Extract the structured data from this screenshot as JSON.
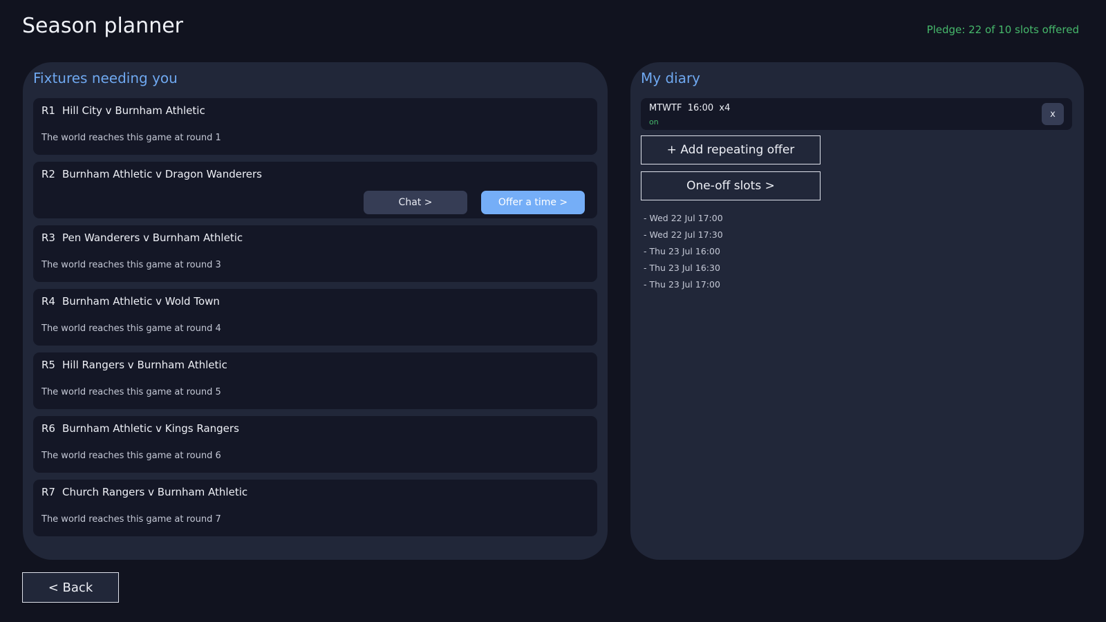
{
  "header": {
    "title": "Season planner",
    "pledge": "Pledge: 22 of 10 slots offered"
  },
  "fixtures": {
    "heading": "Fixtures needing you",
    "items": [
      {
        "round": "R1",
        "match": "Hill City v Burnham Athletic",
        "note": "The world reaches this game at round 1"
      },
      {
        "round": "R2",
        "match": "Burnham Athletic v Dragon Wanderers",
        "chat_label": "Chat >",
        "offer_label": "Offer a time >"
      },
      {
        "round": "R3",
        "match": "Pen Wanderers v Burnham Athletic",
        "note": "The world reaches this game at round 3"
      },
      {
        "round": "R4",
        "match": "Burnham Athletic v Wold Town",
        "note": "The world reaches this game at round 4"
      },
      {
        "round": "R5",
        "match": "Hill Rangers v Burnham Athletic",
        "note": "The world reaches this game at round 5"
      },
      {
        "round": "R6",
        "match": "Burnham Athletic v Kings Rangers",
        "note": "The world reaches this game at round 6"
      },
      {
        "round": "R7",
        "match": "Church Rangers v Burnham Athletic",
        "note": "The world reaches this game at round 7"
      }
    ]
  },
  "diary": {
    "heading": "My diary",
    "repeating_offer": {
      "text": "MTWTF  16:00  x4",
      "status": "on",
      "remove_label": "x"
    },
    "add_repeating_label": "+ Add repeating offer",
    "oneoff_label": "One-off slots >",
    "slots": [
      "- Wed 22 Jul 17:00",
      "- Wed 22 Jul 17:30",
      "- Thu 23 Jul 16:00",
      "- Thu 23 Jul 16:30",
      "- Thu 23 Jul 17:00"
    ]
  },
  "footer": {
    "back_label": "< Back"
  },
  "colors": {
    "background": "#11131f",
    "panel": "#212739",
    "card": "#141726",
    "accent_blue": "#6fa8f0",
    "primary_button": "#75aef7",
    "status_green": "#46b86b"
  }
}
